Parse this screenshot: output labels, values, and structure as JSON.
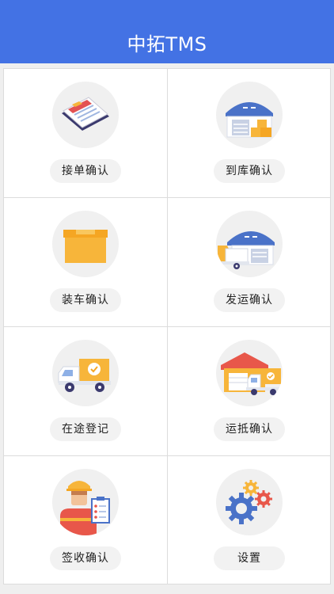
{
  "header": {
    "title": "中拓TMS"
  },
  "menu": [
    {
      "label": "接单确认",
      "icon": "order-clipboard-icon"
    },
    {
      "label": "到库确认",
      "icon": "warehouse-boxes-icon"
    },
    {
      "label": "装车确认",
      "icon": "box-icon"
    },
    {
      "label": "发运确认",
      "icon": "warehouse-truck-icon"
    },
    {
      "label": "在途登记",
      "icon": "delivery-truck-check-icon"
    },
    {
      "label": "运抵确认",
      "icon": "arrived-truck-house-icon"
    },
    {
      "label": "签收确认",
      "icon": "worker-clipboard-icon"
    },
    {
      "label": "设置",
      "icon": "gears-icon"
    }
  ],
  "colors": {
    "header": "#4372e4",
    "orange": "#f7b53a",
    "navy": "#3b3a6e",
    "blue": "#4a72c8",
    "red": "#e74c3c"
  }
}
